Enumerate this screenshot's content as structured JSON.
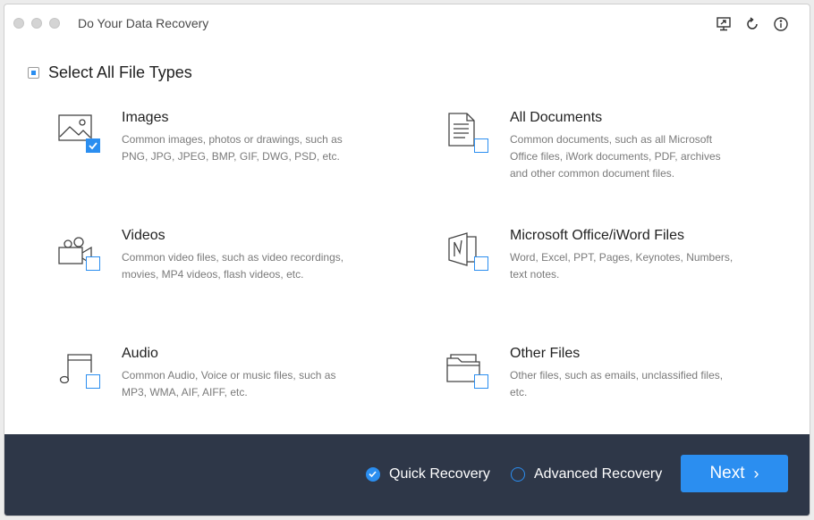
{
  "window": {
    "title": "Do Your Data Recovery"
  },
  "toolbar": {
    "icons": [
      "screen-icon",
      "refresh-icon",
      "info-icon"
    ]
  },
  "select_all": {
    "label": "Select All File Types",
    "state": "partial"
  },
  "file_types": [
    {
      "name": "Images",
      "desc": "Common images, photos or drawings, such as PNG, JPG, JPEG, BMP, GIF, DWG, PSD, etc.",
      "checked": true
    },
    {
      "name": "All Documents",
      "desc": "Common documents, such as all Microsoft Office files, iWork documents, PDF, archives and other common document files.",
      "checked": false
    },
    {
      "name": "Videos",
      "desc": "Common video files, such as video recordings, movies, MP4 videos, flash videos, etc.",
      "checked": false
    },
    {
      "name": "Microsoft Office/iWord Files",
      "desc": "Word, Excel, PPT, Pages, Keynotes, Numbers, text notes.",
      "checked": false
    },
    {
      "name": "Audio",
      "desc": "Common Audio, Voice or music files, such as MP3, WMA, AIF, AIFF, etc.",
      "checked": false
    },
    {
      "name": "Other Files",
      "desc": "Other files, such as emails, unclassified files, etc.",
      "checked": false
    }
  ],
  "footer": {
    "quick_recovery": "Quick Recovery",
    "advanced_recovery": "Advanced Recovery",
    "selected_mode": "quick",
    "next_label": "Next",
    "next_chevron": "›"
  },
  "colors": {
    "accent": "#2b8ef0",
    "footer_bg": "#2e3748"
  }
}
